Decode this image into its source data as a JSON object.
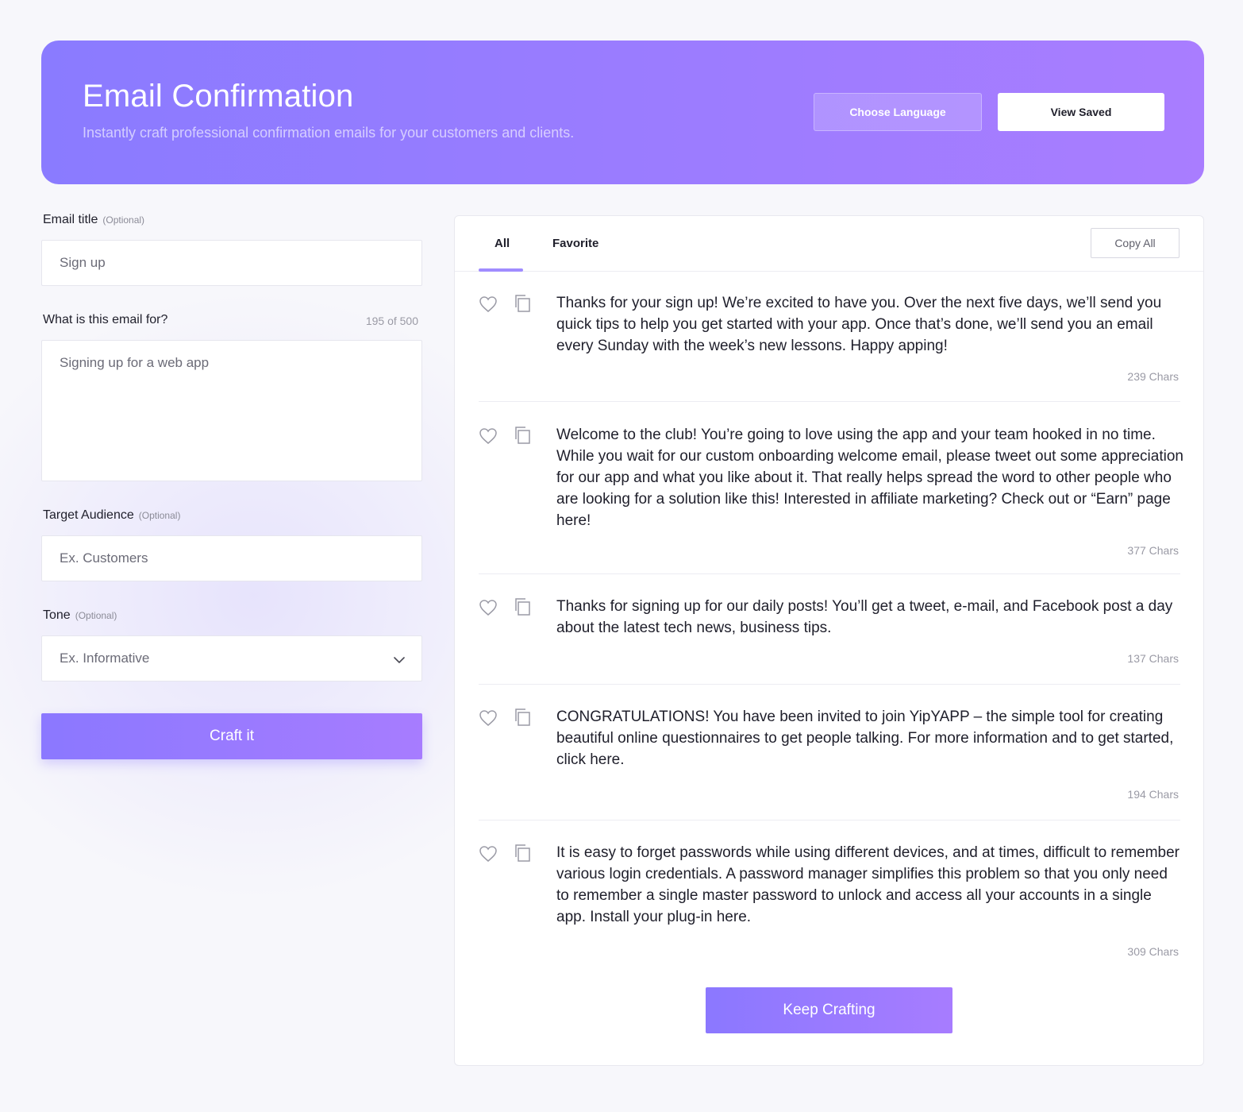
{
  "header": {
    "title": "Email Confirmation",
    "subtitle": "Instantly craft professional confirmation emails for your customers and clients.",
    "choose_language_label": "Choose Language",
    "view_saved_label": "View Saved"
  },
  "form": {
    "email_title": {
      "label": "Email title",
      "optional": "(Optional)",
      "placeholder": "Sign up"
    },
    "purpose": {
      "label": "What is this email for?",
      "counter": "195 of 500",
      "placeholder": "Signing up for a web app"
    },
    "audience": {
      "label": "Target Audience",
      "optional": "(Optional)",
      "placeholder": "Ex. Customers"
    },
    "tone": {
      "label": "Tone",
      "optional": "(Optional)",
      "selected": "Ex. Informative"
    },
    "submit_label": "Craft it"
  },
  "results": {
    "tabs": [
      {
        "label": "All",
        "active": true
      },
      {
        "label": "Favorite",
        "active": false
      }
    ],
    "copy_all_label": "Copy All",
    "items": [
      {
        "text": "Thanks for your sign up! We’re excited to have you. Over the next five days, we’ll send you quick tips to help you get started with your app. Once that’s done, we’ll send you an email every Sunday with the week’s new lessons. Happy apping!",
        "chars": "239 Chars"
      },
      {
        "text": "Welcome to the club! You’re going to love using the app and your team hooked in no time. While you wait for our custom onboarding welcome email, please tweet out some appreciation for our app and what you like about it. That really helps spread the word to other people who are looking for a solution like this! Interested in affiliate marketing? Check out or “Earn” page here!",
        "chars": "377 Chars"
      },
      {
        "text": "Thanks for signing up for our daily posts! You’ll get a tweet, e-mail, and Facebook post a day about the latest tech news, business tips.",
        "chars": "137 Chars"
      },
      {
        "text": "CONGRATULATIONS! You have been invited to join YipYAPP – the simple tool for creating beautiful online questionnaires to get people talking.  For more information and to get started, click here.",
        "chars": "194 Chars"
      },
      {
        "text": "It is easy to forget passwords while using different devices, and at times, difficult to remember various login credentials. A password manager simplifies this problem so that you only need to remember a single master password to unlock and access all your accounts in a single app. Install your plug-in here.",
        "chars": "309 Chars"
      }
    ],
    "keep_crafting_label": "Keep Crafting"
  },
  "colors": {
    "accent": "#9a7cff",
    "accent_light": "#a08cff"
  },
  "icons": {
    "favorite": "heart-icon",
    "copy": "copy-icon",
    "dropdown": "chevron-down-icon"
  }
}
